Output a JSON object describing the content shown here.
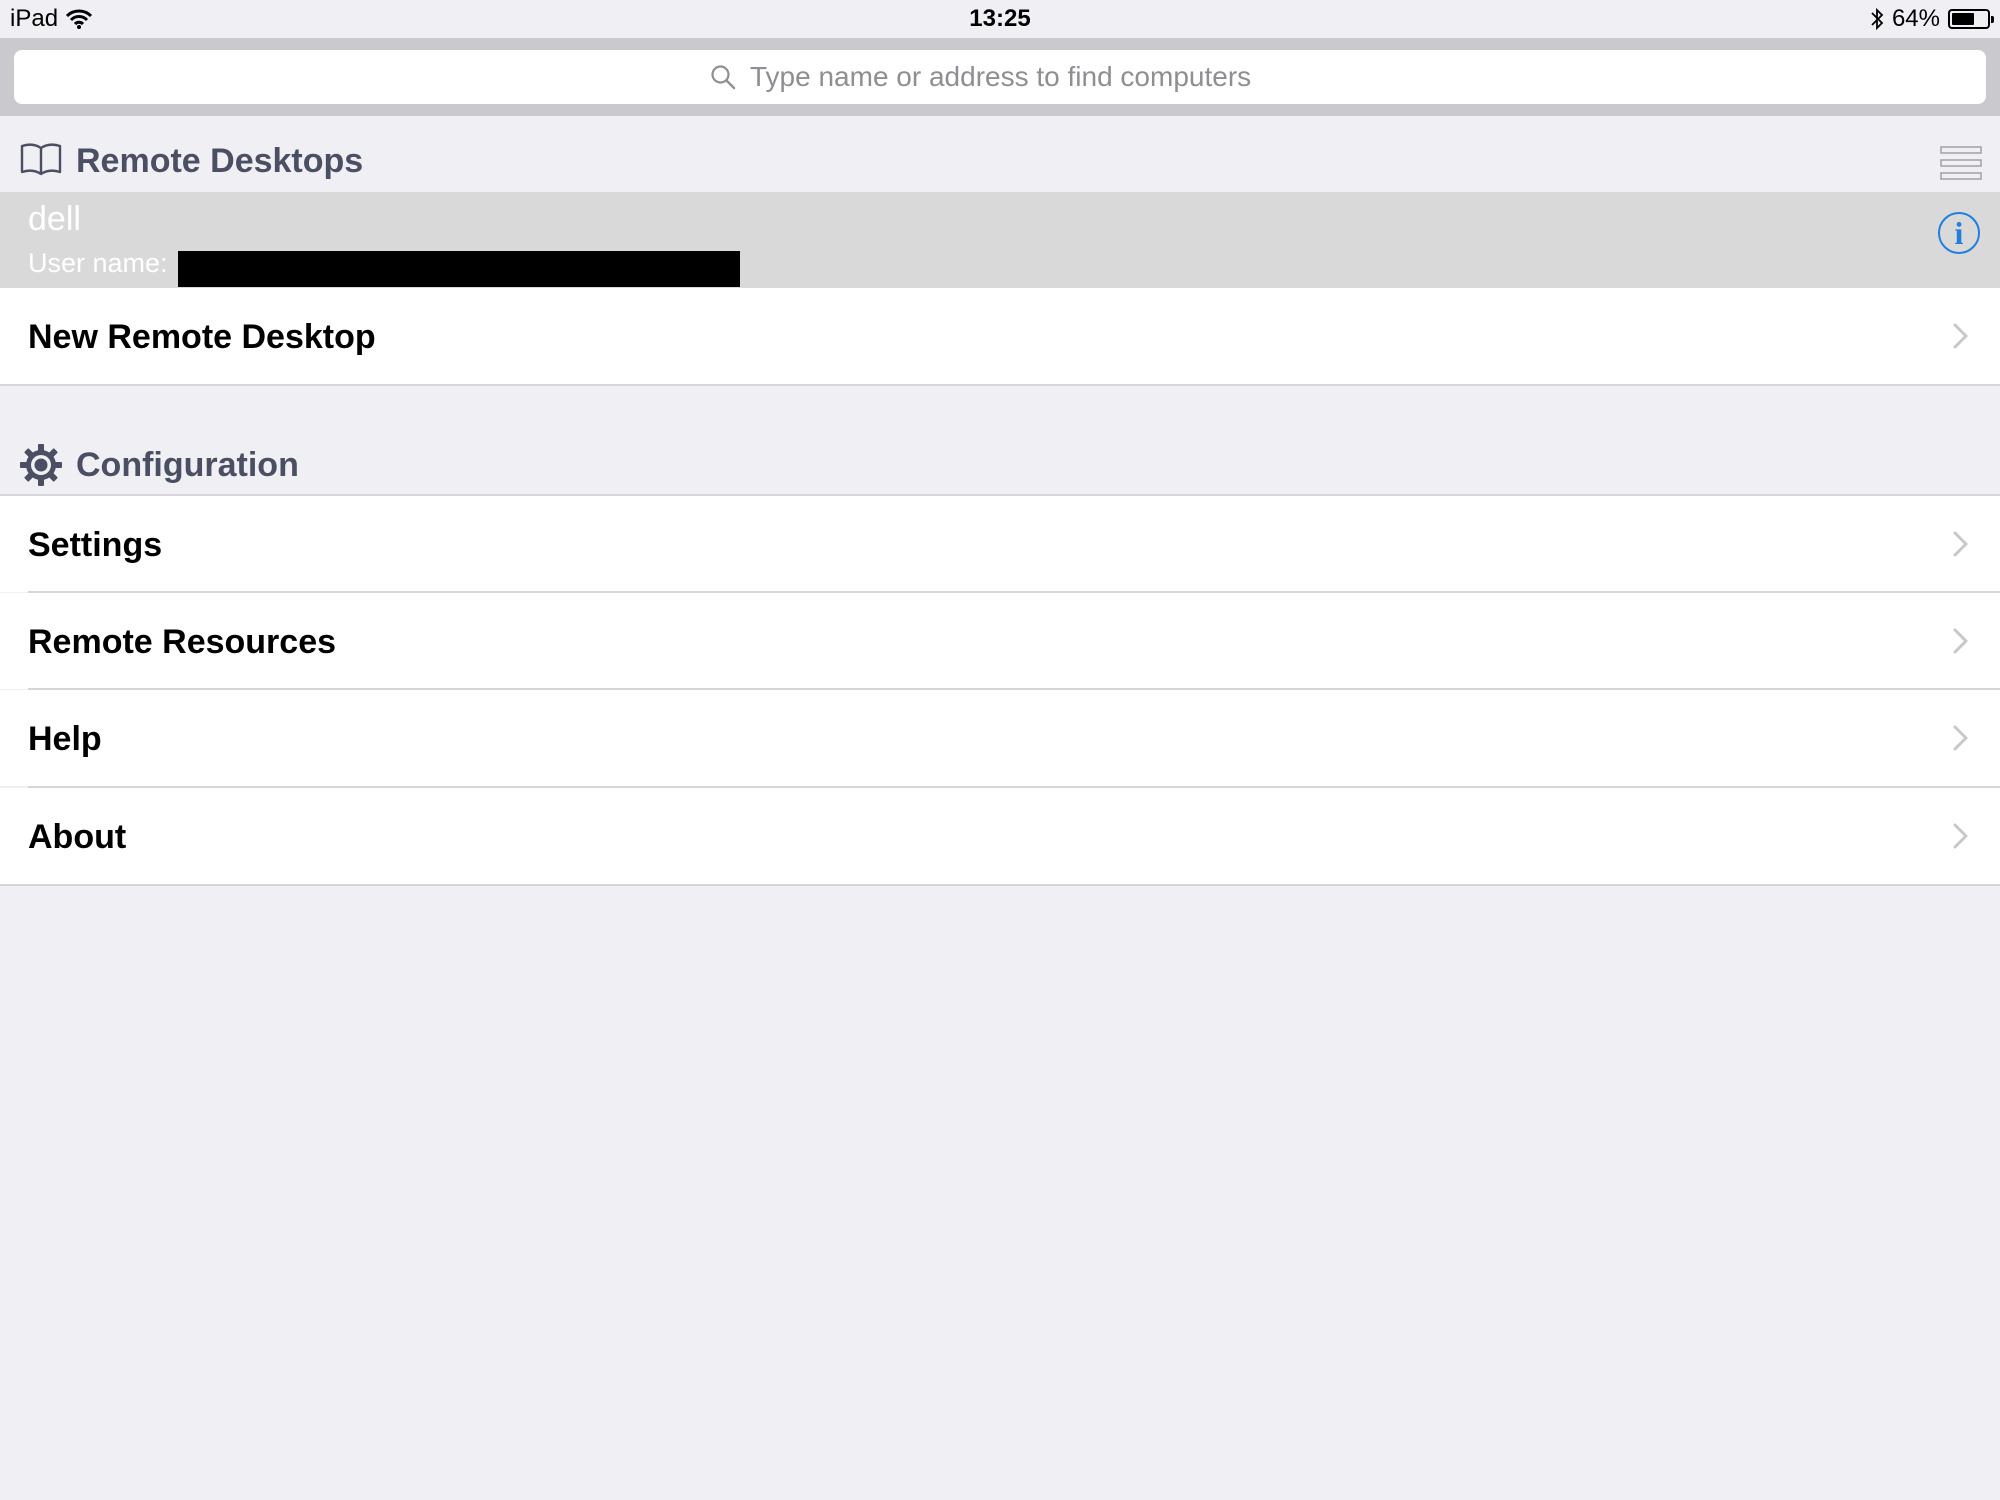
{
  "status_bar": {
    "device": "iPad",
    "time": "13:25",
    "battery_percent": "64%",
    "battery_level": 0.64,
    "icons": [
      "wifi-icon",
      "bluetooth-icon",
      "battery-icon"
    ]
  },
  "search": {
    "placeholder": "Type name or address to find computers",
    "value": ""
  },
  "remote_desktops": {
    "title": "Remote Desktops",
    "icon": "book-icon",
    "view_toggle_icon": "list-view-icon",
    "items": [
      {
        "name": "dell",
        "user_label": "User name:"
      }
    ],
    "new_label": "New Remote Desktop"
  },
  "configuration": {
    "title": "Configuration",
    "icon": "gear-icon",
    "items": [
      {
        "label": "Settings"
      },
      {
        "label": "Remote Resources"
      },
      {
        "label": "Help"
      },
      {
        "label": "About"
      }
    ]
  },
  "colors": {
    "background": "#efeff4",
    "search_bar": "#c9c9ce",
    "header_text": "#4a4f63",
    "selected_row": "#d9d9d9",
    "accent": "#1f7ee0"
  }
}
